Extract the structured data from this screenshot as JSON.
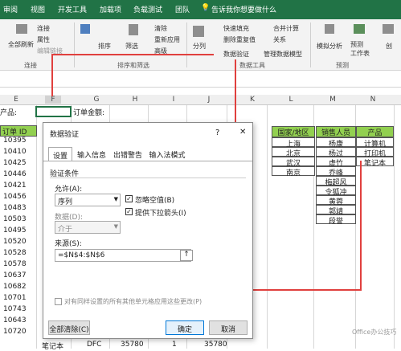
{
  "ribbon_tabs": [
    "审阅",
    "视图",
    "开发工具",
    "加载项",
    "负载测试",
    "团队"
  ],
  "tell_me": "告诉我你想要做什么",
  "ribbon": {
    "refresh_all": "全部刷新",
    "connections": "连接",
    "properties": "属性",
    "edit_links": "编辑链接",
    "sort": "排序",
    "filter": "筛选",
    "clear": "清除",
    "reapply": "重新应用",
    "advanced": "高级",
    "text_to_columns": "分列",
    "flash_fill": "快速填充",
    "remove_duplicates": "删除重复值",
    "data_validation": "数据验证",
    "consolidate": "合并计算",
    "relationships": "关系",
    "manage_model": "管理数据模型",
    "what_if": "模拟分析",
    "forecast_sheet": "预测\n工作表",
    "group": "创",
    "groups": {
      "connections": "连接",
      "sort_filter": "排序和筛选",
      "data_tools": "数据工具",
      "forecast": "预测"
    }
  },
  "columns": [
    "E",
    "F",
    "G",
    "H",
    "I",
    "J",
    "K",
    "L",
    "M",
    "N"
  ],
  "row_e_label": "产品:",
  "row_g_label": "订单金额:",
  "order_id_header": "订单 ID",
  "order_ids": [
    "10395",
    "10410",
    "10425",
    "10446",
    "10421",
    "10456",
    "10483",
    "10503",
    "10495",
    "10520",
    "10528",
    "10578",
    "10637",
    "10682",
    "10701",
    "10743",
    "10643",
    "10720"
  ],
  "bottom_row": {
    "product": "笔记本",
    "code": "DFC",
    "v1": "35780",
    "v2": "1",
    "v3": "35780"
  },
  "table_headers": {
    "country": "国家/地区",
    "sales": "销售人员",
    "product": "产品"
  },
  "countries": [
    "上海",
    "北京",
    "武汉",
    "南京"
  ],
  "salespeople": [
    "杨康",
    "杨过",
    "虚竹",
    "乔峰",
    "梅超风",
    "令狐冲",
    "黄蓉",
    "郭靖",
    "段誉"
  ],
  "products": [
    "计算机",
    "打印机",
    "笔记本"
  ],
  "dialog": {
    "title": "数据验证",
    "help": "?",
    "close": "✕",
    "tabs": [
      "设置",
      "输入信息",
      "出错警告",
      "输入法模式"
    ],
    "section": "验证条件",
    "allow_label": "允许(A):",
    "allow_value": "序列",
    "ignore_blank": "忽略空值(B)",
    "dropdown": "提供下拉箭头(I)",
    "data_label": "数据(D):",
    "data_value": "介于",
    "source_label": "来源(S):",
    "source_value": "=$N$4:$N$6",
    "apply_all": "对有同样设置的所有其他单元格应用这些更改(P)",
    "clear_all": "全部清除(C)",
    "ok": "确定",
    "cancel": "取消"
  },
  "watermark": "Office办公技巧"
}
